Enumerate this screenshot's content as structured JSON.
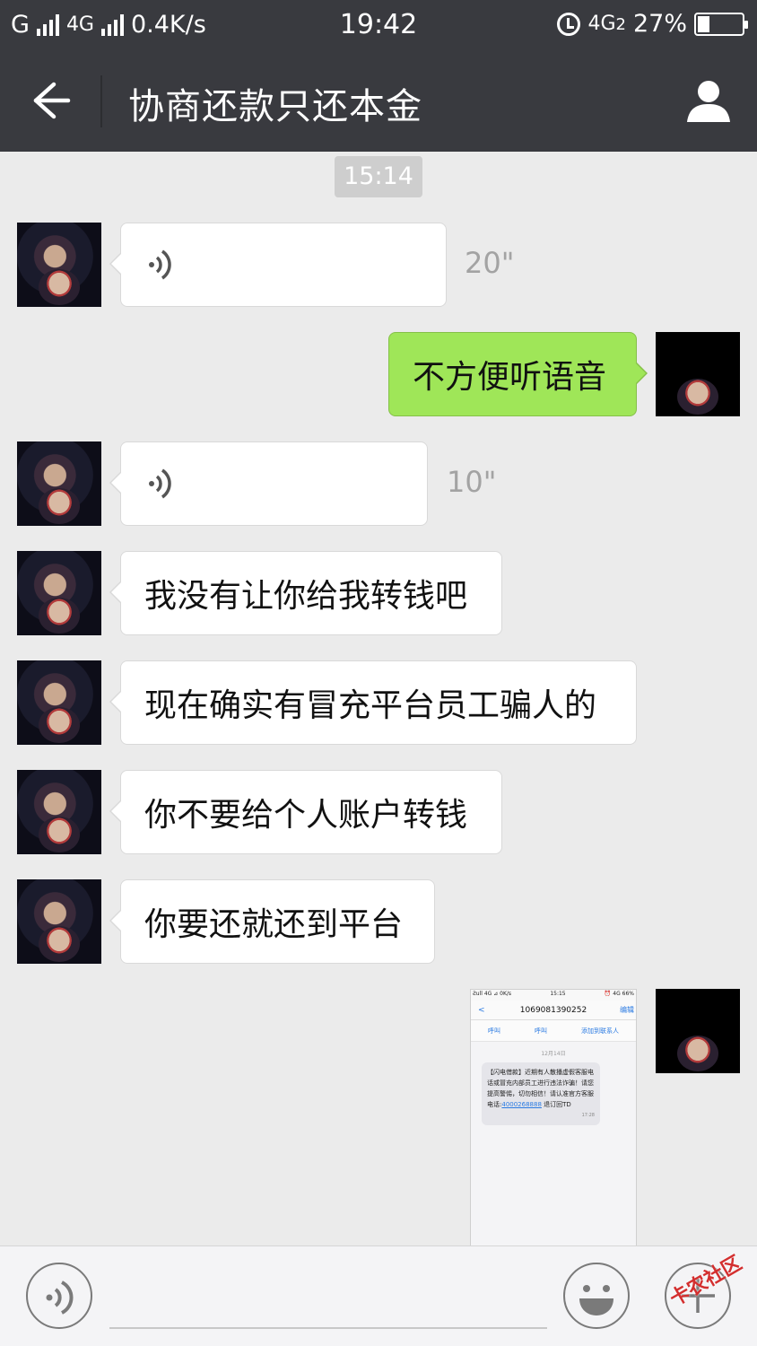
{
  "status_bar": {
    "carrier1": "G",
    "carrier2": "4G",
    "net_speed": "0.4K/s",
    "time": "19:42",
    "net_type": "4G",
    "sim": "2",
    "battery": "27%",
    "battery_level": 0.27
  },
  "header": {
    "title": "协商还款只还本金"
  },
  "chat": {
    "timestamp": "15:14",
    "messages": [
      {
        "from": "other",
        "type": "voice",
        "duration": "20\""
      },
      {
        "from": "self",
        "type": "text",
        "text": "不方便听语音"
      },
      {
        "from": "other",
        "type": "voice",
        "duration": "10\""
      },
      {
        "from": "other",
        "type": "text",
        "text": "我没有让你给我转钱吧"
      },
      {
        "from": "other",
        "type": "text",
        "text": "现在确实有冒充平台员工骗人的"
      },
      {
        "from": "other",
        "type": "text",
        "text": "你不要给个人账户转钱"
      },
      {
        "from": "other",
        "type": "text",
        "text": "你要还就还到平台"
      },
      {
        "from": "self",
        "type": "image"
      }
    ]
  },
  "screenshot_image": {
    "status_left": "Ƨull 4G ⊿ 0K/s",
    "status_time": "15:15",
    "status_right": "⏰ 4G 66%",
    "back": "<",
    "sender": "1069081390252",
    "edit": "编辑",
    "action1": "呼叫",
    "action2": "呼叫",
    "action3": "添加到联系人",
    "date": "12月14日",
    "sms_text": "【闪电借款】近期有人散播虚假客服电话或冒充内部员工进行违法诈骗！请您提高警惕，切勿相信！请认准官方客服电话:",
    "sms_phone": "4000268888",
    "sms_tail": " 退订回TD",
    "sms_time": "17:28"
  },
  "watermark": "卡农社区",
  "icons": {
    "back": "back-arrow-icon",
    "profile": "person-icon",
    "voice": "voice-wave-icon",
    "emoji": "smiley-icon",
    "plus": "plus-icon"
  }
}
